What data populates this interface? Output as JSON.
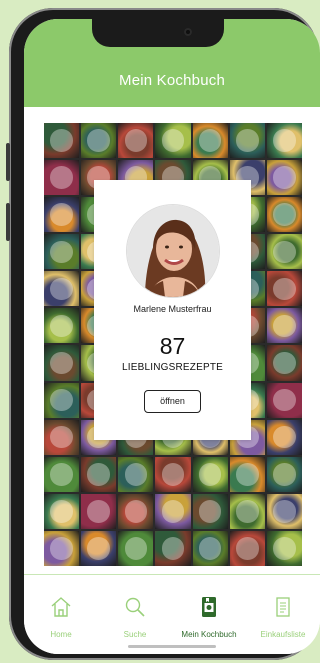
{
  "colors": {
    "background": "#d9ecc2",
    "header": "#8cc96a",
    "tab_inactive": "#9ad07a",
    "tab_active": "#2f6a2b"
  },
  "header": {
    "title": "Mein Kochbuch"
  },
  "profile": {
    "name": "Marlene Musterfrau",
    "recipe_count": "87",
    "recipes_label": "LIEBLINGSREZEPTE",
    "open_button": "öffnen"
  },
  "tabbar": {
    "items": [
      {
        "label": "Home",
        "icon": "home-icon",
        "active": false
      },
      {
        "label": "Suche",
        "icon": "search-icon",
        "active": false
      },
      {
        "label": "Mein Kochbuch",
        "icon": "cookbook-icon",
        "active": true
      },
      {
        "label": "Einkaufsliste",
        "icon": "shopping-list-icon",
        "active": false
      }
    ]
  }
}
